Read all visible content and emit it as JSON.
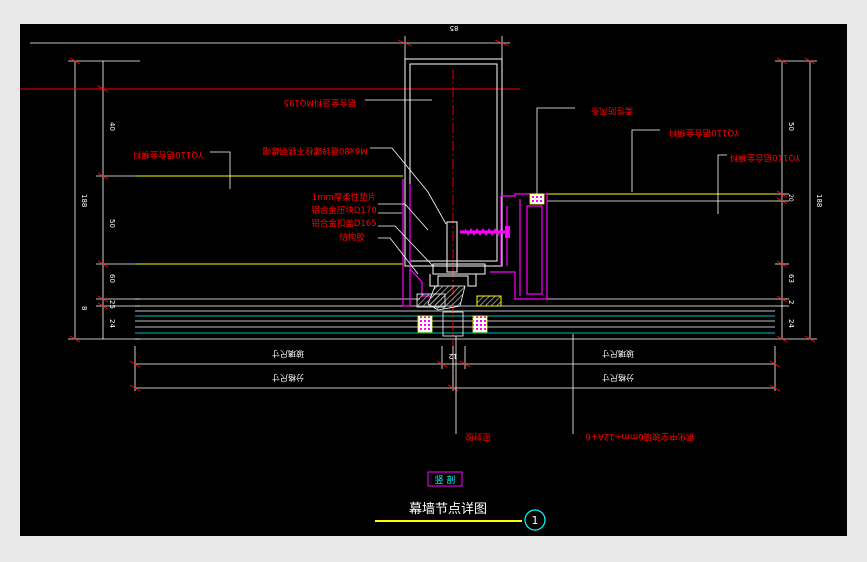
{
  "drawing": {
    "title": "幕墙节点详图",
    "detail_number": "1",
    "section_tag": "竖 剖",
    "colors": {
      "background": "#000000",
      "frame": "#e9e9ea",
      "red": "#ff0000",
      "magenta": "#ff00ff",
      "yellow": "#ffff00",
      "white": "#ffffff",
      "cyan": "#00ffff",
      "hatch": "#c0c0c0"
    }
  },
  "dimensions": {
    "top_width": "85",
    "left_heights": [
      "40",
      "188",
      "50",
      "60",
      "25",
      "8",
      "24"
    ],
    "right_heights": [
      "50",
      "188",
      "20",
      "63",
      "2",
      "24"
    ],
    "gap": "12",
    "panel_size_left": "玻璃尺寸",
    "panel_size_right": "玻璃尺寸",
    "grid_size_left": "分格尺寸",
    "grid_size_right": "分格尺寸"
  },
  "labels": {
    "mullion": "铝合金竖料MQ195",
    "bolt": "M6x80镀锌螺栓不锈钢螺帽",
    "left_profile": "YQ110铝合金横料",
    "gasket": "1mm厚柔性垫片",
    "pressure_plate": "铝合金压块D170",
    "cover_cap": "铝合金扣盖D165",
    "foam_rod": "结构胶",
    "weather_strip": "柔性防风条",
    "right_profile_1": "YQ110铝合金横料",
    "right_profile_2": "YQ110铝合金横料",
    "sealant": "密封胶",
    "glass": "钢化中空玻璃6mm+12A+6"
  }
}
